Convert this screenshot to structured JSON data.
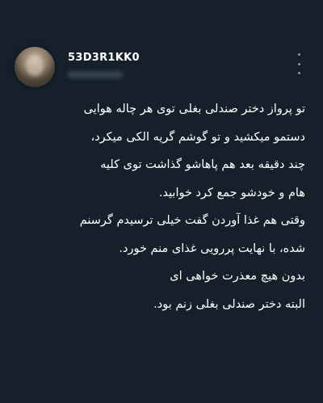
{
  "user": {
    "display_name": "53D3R1KK0"
  },
  "icons": {
    "more": "more-vertical-icon"
  },
  "tweet": {
    "lines": [
      "تو پرواز دختر صندلی بغلی توی هر چاله هوایی",
      "دستمو میکشید و تو گوشم گریه الکی میکرد،",
      "چند دقیقه بعد هم پاهاشو گذاشت توی کلیه",
      "هام و خودشو جمع کرد خوابید.",
      "وقتی هم غذا آوردن گفت خیلی ترسیدم گرسنم",
      "شده، با نهایت پررویی غذای منم خورد.",
      "بدون هیچ معذرت خواهی ای",
      "البته دختر صندلی بغلی زنم بود."
    ]
  },
  "colors": {
    "background": "#15202b",
    "text": "#ffffff",
    "muted": "#8899a6"
  }
}
